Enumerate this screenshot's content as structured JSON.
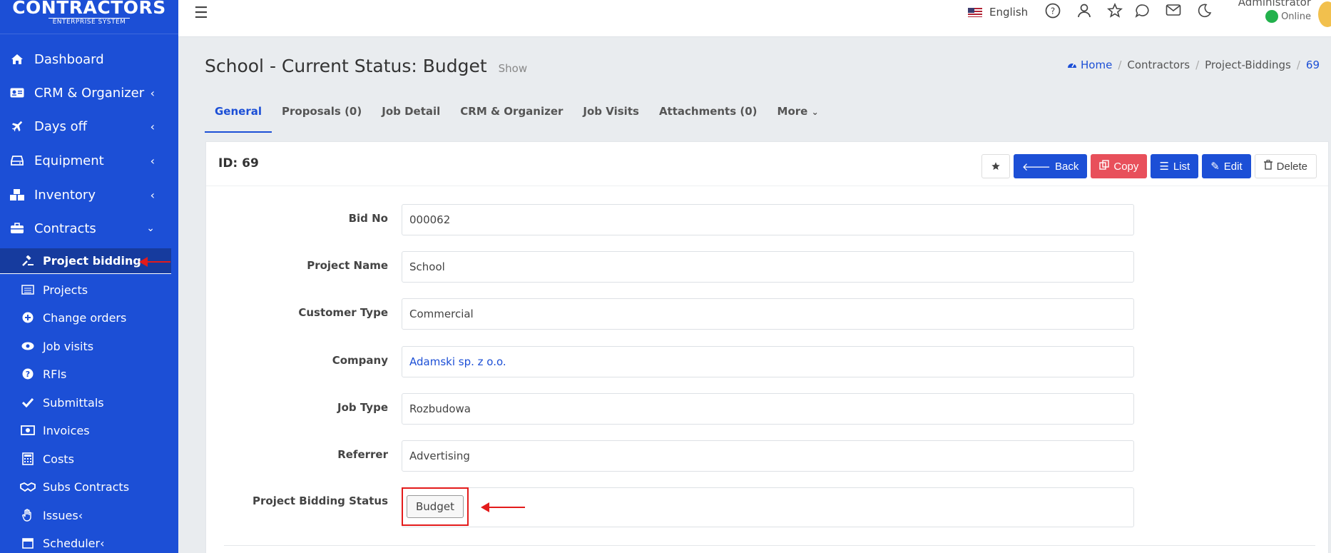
{
  "brand": {
    "logo": "CONTRACTORS",
    "subtitle": "ENTERPRISE SYSTEM"
  },
  "sidebar": {
    "items": [
      {
        "label": "Dashboard",
        "icon": "home-icon"
      },
      {
        "label": "CRM & Organizer",
        "icon": "id-card-icon"
      },
      {
        "label": "Days off",
        "icon": "plane-icon"
      },
      {
        "label": "Equipment",
        "icon": "hard-drive-icon"
      },
      {
        "label": "Inventory",
        "icon": "boxes-icon"
      },
      {
        "label": "Contracts",
        "icon": "briefcase-icon"
      }
    ],
    "subitems": [
      {
        "label": "Project bidding",
        "icon": "gavel-icon",
        "active": true
      },
      {
        "label": "Projects",
        "icon": "list-alt-icon"
      },
      {
        "label": "Change orders",
        "icon": "plus-circle-icon"
      },
      {
        "label": "Job visits",
        "icon": "eye-icon"
      },
      {
        "label": "RFIs",
        "icon": "question-circle-icon"
      },
      {
        "label": "Submittals",
        "icon": "check-icon"
      },
      {
        "label": "Invoices",
        "icon": "money-bill-icon"
      },
      {
        "label": "Costs",
        "icon": "calculator-icon"
      },
      {
        "label": "Subs Contracts",
        "icon": "handshake-icon"
      },
      {
        "label": "Issues",
        "icon": "hand-icon"
      },
      {
        "label": "Scheduler",
        "icon": "calendar-icon"
      }
    ]
  },
  "topbar": {
    "language": "English",
    "user_name": "Administrator",
    "user_status": "Online"
  },
  "page": {
    "title": "School - Current Status: Budget",
    "subtitle": "Show",
    "breadcrumb": [
      "Home",
      "Contractors",
      "Project-Biddings",
      "69"
    ]
  },
  "tabs": [
    "General",
    "Proposals (0)",
    "Job Detail",
    "CRM & Organizer",
    "Job Visits",
    "Attachments (0)",
    "More"
  ],
  "card": {
    "id_label": "ID: 69",
    "actions": {
      "back": "Back",
      "copy": "Copy",
      "list": "List",
      "edit": "Edit",
      "delete": "Delete"
    }
  },
  "fields": [
    {
      "label": "Bid No",
      "value": "000062"
    },
    {
      "label": "Project Name",
      "value": "School"
    },
    {
      "label": "Customer Type",
      "value": "Commercial"
    },
    {
      "label": "Company",
      "value": "Adamski sp. z o.o."
    },
    {
      "label": "Job Type",
      "value": "Rozbudowa"
    },
    {
      "label": "Referrer",
      "value": "Advertising"
    }
  ],
  "status": {
    "label": "Project Bidding Status",
    "value": "Budget"
  },
  "colors": {
    "primary": "#1c4fd6",
    "danger": "#e8505b",
    "highlight": "#e31b1b"
  }
}
